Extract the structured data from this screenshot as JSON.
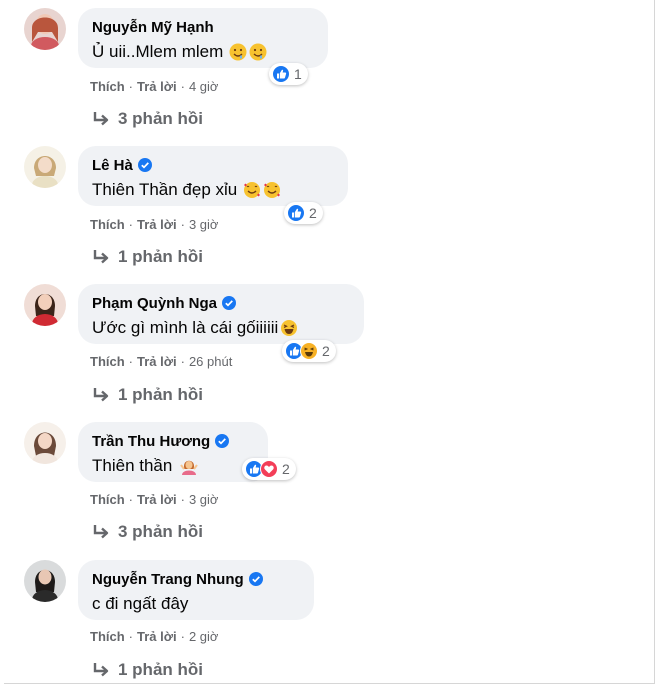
{
  "comments": [
    {
      "author": "Nguyễn Mỹ Hạnh",
      "verified": false,
      "text": "Ủ uii..Mlem mlem",
      "emojis": [
        "drooling-face-icon",
        "drooling-face-icon"
      ],
      "reactions": [
        "like-icon"
      ],
      "reaction_count": "1",
      "like_label": "Thích",
      "reply_label": "Trả lời",
      "time": "4 giờ",
      "replies": "3 phản hồi"
    },
    {
      "author": "Lê Hà",
      "verified": true,
      "text": "Thiên Thần đẹp xỉu",
      "emojis": [
        "smiling-face-with-hearts-icon",
        "smiling-face-with-hearts-icon"
      ],
      "reactions": [
        "like-icon"
      ],
      "reaction_count": "2",
      "like_label": "Thích",
      "reply_label": "Trả lời",
      "time": "3 giờ",
      "replies": "1 phản hồi"
    },
    {
      "author": "Phạm Quỳnh Nga",
      "verified": true,
      "text": "Ước gì mình là cái gốiiiiii",
      "emojis": [
        "laughing-face-icon"
      ],
      "reactions": [
        "like-icon",
        "haha-icon"
      ],
      "reaction_count": "2",
      "like_label": "Thích",
      "reply_label": "Trả lời",
      "time": "26 phút",
      "replies": "1 phản hồi"
    },
    {
      "author": "Trần Thu Hương",
      "verified": true,
      "text": "Thiên thần",
      "emojis": [
        "person-gesturing-icon"
      ],
      "reactions": [
        "like-icon",
        "love-icon"
      ],
      "reaction_count": "2",
      "like_label": "Thích",
      "reply_label": "Trả lời",
      "time": "3 giờ",
      "replies": "3 phản hồi"
    },
    {
      "author": "Nguyễn Trang Nhung",
      "verified": true,
      "text": "c đi ngất đây",
      "emojis": [],
      "reactions": [],
      "reaction_count": "",
      "like_label": "Thích",
      "reply_label": "Trả lời",
      "time": "2 giờ",
      "replies": "1 phản hồi"
    }
  ],
  "colors": {
    "bubble": "#f0f2f5",
    "secondary_text": "#65676b",
    "verified": "#1877f2",
    "like": "#1877f2",
    "love": "#f33e58",
    "haha": "#f7b125"
  }
}
